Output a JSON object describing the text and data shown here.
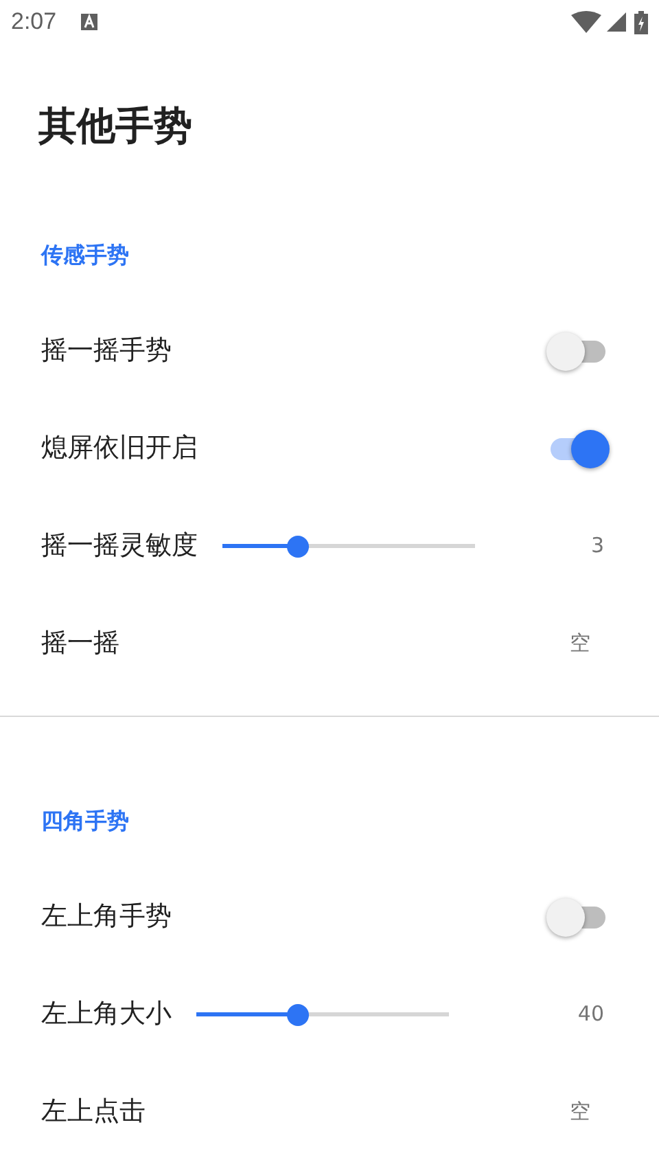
{
  "status_bar": {
    "time": "2:07"
  },
  "title": "其他手势",
  "sections": [
    {
      "header": "传感手势",
      "rows": [
        {
          "kind": "switch",
          "label": "摇一摇手势",
          "on": false
        },
        {
          "kind": "switch",
          "label": "熄屏依旧开启",
          "on": true
        },
        {
          "kind": "slider",
          "label": "摇一摇灵敏度",
          "level": 0.3,
          "value": "3"
        },
        {
          "kind": "value",
          "label": "摇一摇",
          "value": "空"
        }
      ]
    },
    {
      "header": "四角手势",
      "rows": [
        {
          "kind": "switch",
          "label": "左上角手势",
          "on": false
        },
        {
          "kind": "slider",
          "label": "左上角大小",
          "level": 0.4,
          "value": "40"
        },
        {
          "kind": "value",
          "label": "左上点击",
          "value": "空"
        }
      ]
    }
  ]
}
